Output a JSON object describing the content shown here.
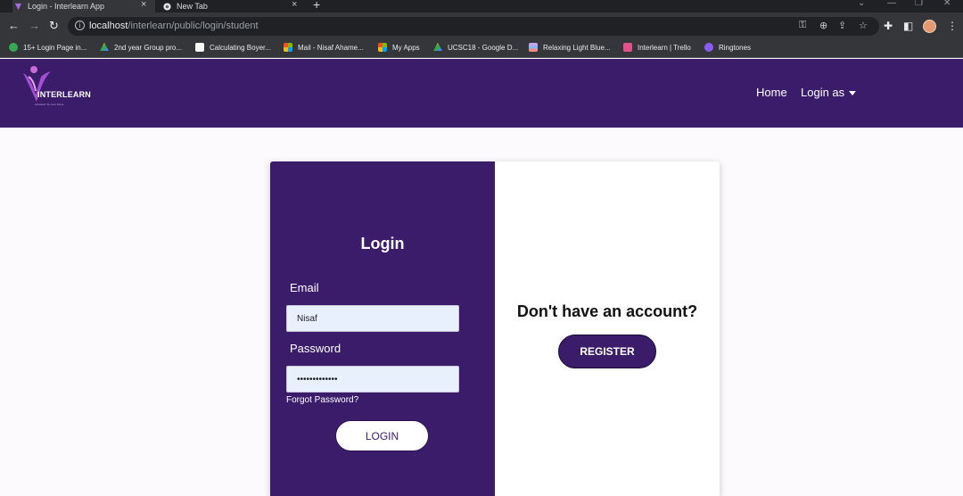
{
  "browser": {
    "tabs": [
      {
        "title": "Login - Interlearn App",
        "active": true
      },
      {
        "title": "New Tab",
        "active": false
      }
    ],
    "address": {
      "host": "localhost",
      "path": "/interlearn/public/login/student"
    },
    "bookmarks": [
      {
        "label": "15+ Login Page in...",
        "color": "#34a853"
      },
      {
        "label": "2nd year Group pro...",
        "color": "#fbbc04"
      },
      {
        "label": "Calculating Boyer...",
        "color": "#ffffff"
      },
      {
        "label": "Mail - Nisaf Ahame...",
        "color": "#f25022"
      },
      {
        "label": "My Apps",
        "color": "#f25022"
      },
      {
        "label": "UCSC18 - Google D...",
        "color": "#fbbc04"
      },
      {
        "label": "Relaxing Light Blue...",
        "color": "#c3a6f0"
      },
      {
        "label": "Interlearn | Trello",
        "color": "#e4508c"
      },
      {
        "label": "Ringtones",
        "color": "#8a5cf6"
      }
    ]
  },
  "site": {
    "brand": "INTERLEARN",
    "tagline": "education for your future",
    "nav": {
      "home": "Home",
      "login_as": "Login as"
    },
    "colors": {
      "primary": "#3b1c6b",
      "field_bg": "#e8f0fe"
    }
  },
  "login": {
    "title": "Login",
    "email_label": "Email",
    "email_value": "Nisaf",
    "password_label": "Password",
    "password_value": "•••••••••••••",
    "forgot": "Forgot Password?",
    "button": "LOGIN"
  },
  "register": {
    "question": "Don't have an account?",
    "button": "REGISTER"
  }
}
